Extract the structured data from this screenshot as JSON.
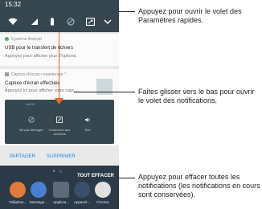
{
  "status_bar": {
    "time": "15:32"
  },
  "notifications": {
    "system": {
      "app_name": "Système Android",
      "title": "USB pour le transfert de fichiers",
      "text": "Appuyez pour afficher plus d'options."
    },
    "screenshot": {
      "app_name": "Capture d'écran • maintenant ^",
      "title": "Capture d'écran effectuée",
      "text": "Appuyez ici pour afficher votre capt..."
    },
    "preview": {
      "time_label": "Vol 02",
      "tiles": [
        {
          "label": "Ne pas déranger"
        },
        {
          "label": "Connexion aux données"
        },
        {
          "label": "Son"
        }
      ]
    },
    "actions": {
      "share": "PARTAGER",
      "delete": "SUPPRIMER"
    }
  },
  "home": {
    "clear_all": "TOUT EFFACER",
    "dock": [
      {
        "label": "Téléphon..."
      },
      {
        "label": "Message..."
      },
      {
        "label": "Applicat..."
      },
      {
        "label": "Appareil..."
      },
      {
        "label": "Chrome"
      }
    ]
  },
  "callouts": {
    "top": "Appuyez pour ouvrir le volet des Paramètres rapides.",
    "middle": "Faites glisser vers le bas pour ouvrir le volet des notifications.",
    "bottom": "Appuyez pour effacer toutes les notifications (les notifications en cours sont conservées)."
  },
  "colors": {
    "accent_arrow": "#e36a2a",
    "share_action": "#1e88e5",
    "panel_dark": "#37474f"
  }
}
